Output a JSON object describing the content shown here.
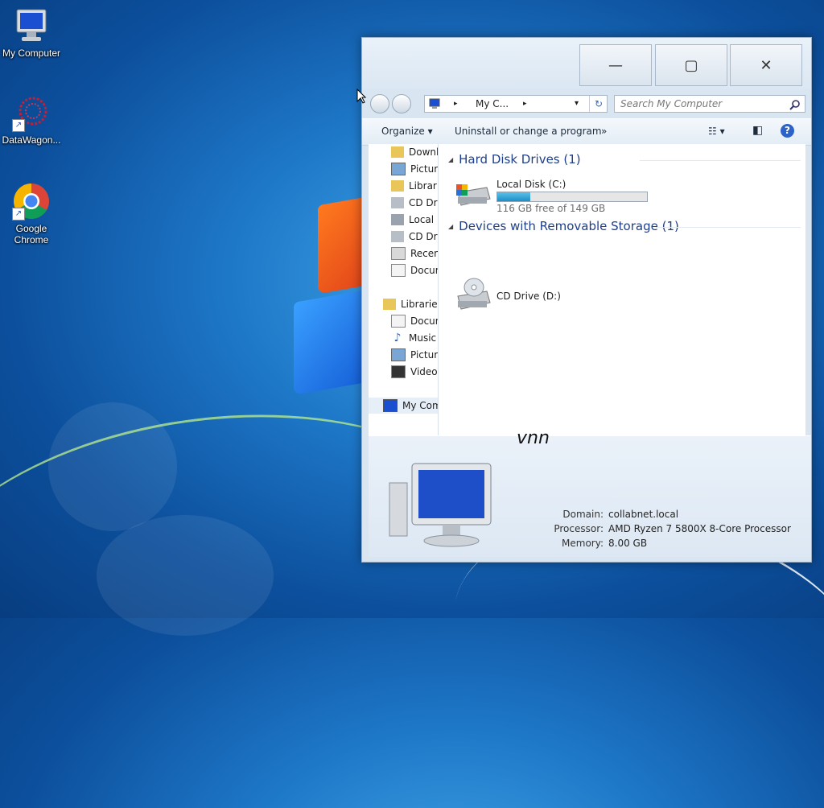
{
  "desktop": {
    "icons": [
      {
        "label": "My Computer",
        "icon": "monitor-icon"
      },
      {
        "label": "DataWagon...",
        "icon": "datawagon-icon"
      },
      {
        "label": "Google Chrome",
        "icon": "chrome-icon"
      }
    ]
  },
  "window": {
    "title_buttons": {
      "minimize": "—",
      "maximize": "▢",
      "close": "✕"
    },
    "address": {
      "separator": "▸",
      "crumb": "My C...",
      "dropdown": "▾",
      "refresh": "↻"
    },
    "search": {
      "placeholder": "Search My Computer",
      "icon": "search-icon"
    },
    "toolbar": {
      "organize": "Organize ▾",
      "uninstall": "Uninstall or change a program",
      "more": "»",
      "views": "☷ ▾",
      "pane": "◧",
      "help": "?"
    },
    "navpane": {
      "favorites": [
        "Downlo",
        "Picture",
        "Librarie",
        "CD Driv",
        "Local D",
        "CD Driv",
        "Recent",
        "Docum"
      ],
      "libraries_header": "Libraries",
      "libraries": [
        "Docum",
        "Music",
        "Picture",
        "Videos"
      ],
      "computer": "My Comp"
    },
    "content": {
      "hdd_group": "Hard Disk Drives (1)",
      "local_disk": {
        "name": "Local Disk (C:)",
        "free_text": "116 GB free of 149 GB",
        "used_fraction": 0.22
      },
      "removable_group": "Devices with Removable Storage (1)",
      "cd_drive": {
        "name": "CD Drive (D:)"
      }
    },
    "details": {
      "domain_label": "Domain:",
      "domain": "collabnet.local",
      "processor_label": "Processor:",
      "processor": "AMD Ryzen 7 5800X 8-Core Processor",
      "memory_label": "Memory:",
      "memory": "8.00 GB",
      "clipped_text": "vnn"
    }
  }
}
